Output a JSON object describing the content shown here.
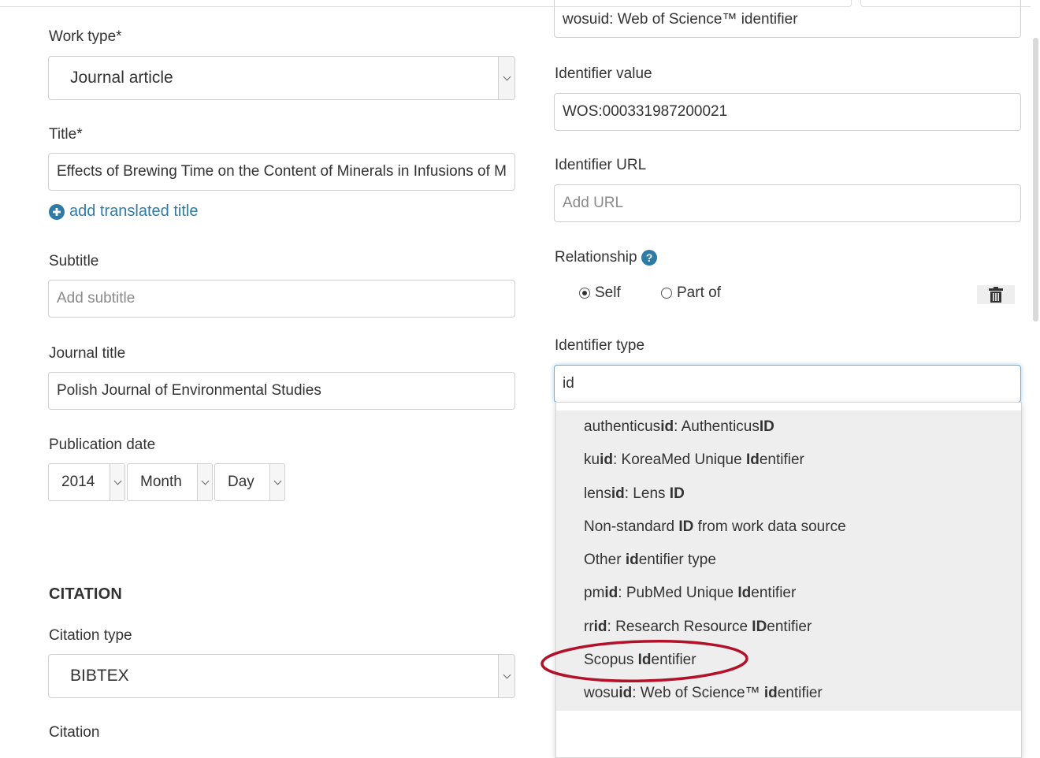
{
  "left": {
    "work_type": {
      "label": "Work type*",
      "value": "Journal article"
    },
    "title": {
      "label": "Title*",
      "value": "Effects of Brewing Time on the Content of Minerals in Infusions of Medicinal Herbs"
    },
    "add_translated_title": "add translated title",
    "subtitle": {
      "label": "Subtitle",
      "placeholder": "Add subtitle"
    },
    "journal_title": {
      "label": "Journal title",
      "value": "Polish Journal of Environmental Studies"
    },
    "publication_date": {
      "label": "Publication date",
      "year": "2014",
      "month": "Month",
      "day": "Day"
    },
    "citation_section": "CITATION",
    "citation_type": {
      "label": "Citation type",
      "value": "BIBTEX"
    },
    "citation_label": "Citation"
  },
  "right": {
    "top_identifier_value": "wosuid: Web of Science™ identifier",
    "identifier_value": {
      "label": "Identifier value",
      "value": "WOS:000331987200021"
    },
    "identifier_url": {
      "label": "Identifier URL",
      "placeholder": "Add URL"
    },
    "relationship": {
      "label": "Relationship",
      "self": "Self",
      "part_of": "Part of",
      "selected": "Self"
    },
    "identifier_type": {
      "label": "Identifier type",
      "value": "id"
    }
  },
  "dropdown": {
    "items": [
      {
        "parts": [
          {
            "t": "authenticus",
            "b": false
          },
          {
            "t": "id",
            "b": true
          },
          {
            "t": ": Authenticus",
            "b": false
          },
          {
            "t": "ID",
            "b": true
          }
        ]
      },
      {
        "parts": [
          {
            "t": "ku",
            "b": false
          },
          {
            "t": "id",
            "b": true
          },
          {
            "t": ": KoreaMed Unique ",
            "b": false
          },
          {
            "t": "Id",
            "b": true
          },
          {
            "t": "entifier",
            "b": false
          }
        ]
      },
      {
        "parts": [
          {
            "t": "lens",
            "b": false
          },
          {
            "t": "id",
            "b": true
          },
          {
            "t": ": Lens ",
            "b": false
          },
          {
            "t": "ID",
            "b": true
          }
        ]
      },
      {
        "parts": [
          {
            "t": "Non-standard ",
            "b": false
          },
          {
            "t": "ID",
            "b": true
          },
          {
            "t": " from work data source",
            "b": false
          }
        ]
      },
      {
        "parts": [
          {
            "t": "Other ",
            "b": false
          },
          {
            "t": "id",
            "b": true
          },
          {
            "t": "entifier type",
            "b": false
          }
        ]
      },
      {
        "parts": [
          {
            "t": "pm",
            "b": false
          },
          {
            "t": "id",
            "b": true
          },
          {
            "t": ": PubMed Unique ",
            "b": false
          },
          {
            "t": "Id",
            "b": true
          },
          {
            "t": "entifier",
            "b": false
          }
        ]
      },
      {
        "parts": [
          {
            "t": "rr",
            "b": false
          },
          {
            "t": "id",
            "b": true
          },
          {
            "t": ": Research Resource ",
            "b": false
          },
          {
            "t": "ID",
            "b": true
          },
          {
            "t": "entifier",
            "b": false
          }
        ]
      },
      {
        "parts": [
          {
            "t": "Scopus ",
            "b": false
          },
          {
            "t": "Id",
            "b": true
          },
          {
            "t": "entifier",
            "b": false
          }
        ]
      },
      {
        "parts": [
          {
            "t": "wosu",
            "b": false
          },
          {
            "t": "id",
            "b": true
          },
          {
            "t": ": Web of Science™ ",
            "b": false
          },
          {
            "t": "id",
            "b": true
          },
          {
            "t": "entifier",
            "b": false
          }
        ]
      }
    ],
    "highlight_color": "#b3112a"
  },
  "colors": {
    "link": "#2e7ca6",
    "focus_border": "#66afe9",
    "help_icon": "#2e7ca6"
  }
}
